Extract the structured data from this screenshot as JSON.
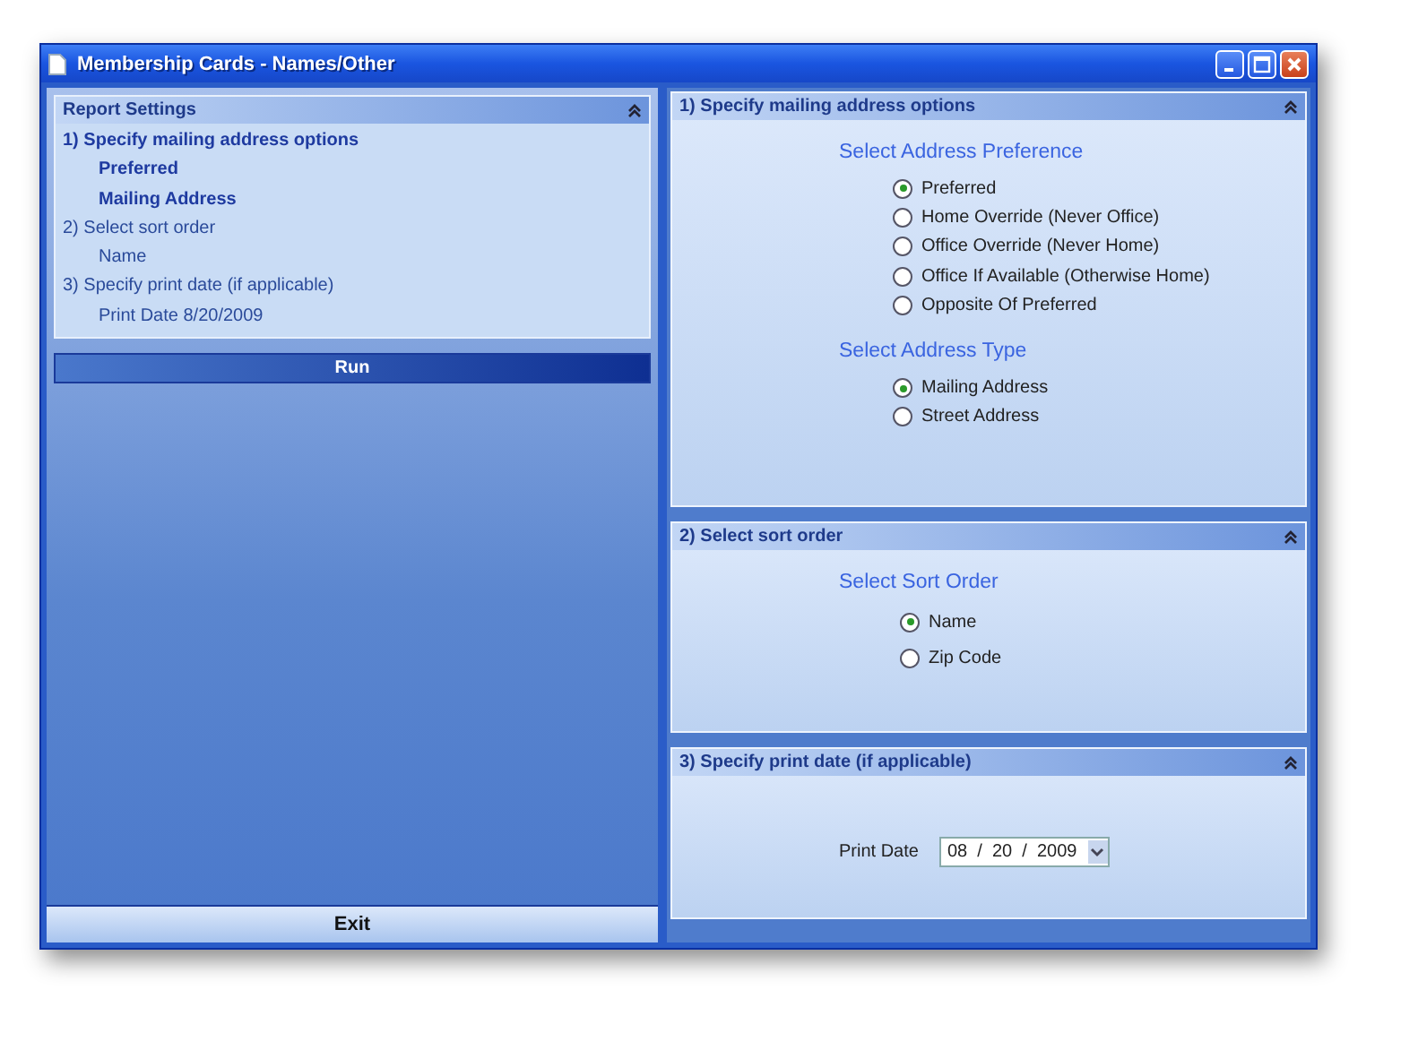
{
  "window": {
    "title": "Membership Cards - Names/Other"
  },
  "summary": {
    "title": "Report Settings",
    "items": [
      {
        "kind": "step",
        "bold": true,
        "text": "1)  Specify mailing address options"
      },
      {
        "kind": "value",
        "bold": true,
        "text": "Preferred"
      },
      {
        "kind": "value",
        "bold": true,
        "text": "Mailing Address"
      },
      {
        "kind": "step",
        "bold": false,
        "text": "2)  Select sort order"
      },
      {
        "kind": "value",
        "bold": false,
        "text": "Name"
      },
      {
        "kind": "step",
        "bold": false,
        "text": "3)  Specify print date (if applicable)"
      },
      {
        "kind": "value",
        "bold": false,
        "text": "Print Date  8/20/2009"
      }
    ]
  },
  "run_button": "Run",
  "exit_button": "Exit",
  "sections": [
    {
      "title": "1)  Specify mailing address options",
      "groups": [
        {
          "heading": "Select Address Preference",
          "options": [
            {
              "label": "Preferred",
              "selected": true
            },
            {
              "label": "Home Override (Never Office)",
              "selected": false
            },
            {
              "label": "Office Override (Never Home)",
              "selected": false
            },
            {
              "label": "Office If Available (Otherwise Home)",
              "selected": false
            },
            {
              "label": "Opposite Of Preferred",
              "selected": false
            }
          ]
        },
        {
          "heading": "Select Address Type",
          "options": [
            {
              "label": "Mailing Address",
              "selected": true
            },
            {
              "label": "Street Address",
              "selected": false
            }
          ]
        }
      ]
    },
    {
      "title": "2)  Select sort order",
      "groups": [
        {
          "heading": "Select Sort Order",
          "options": [
            {
              "label": "Name",
              "selected": true
            },
            {
              "label": "Zip Code",
              "selected": false
            }
          ]
        }
      ]
    },
    {
      "title": "3)  Specify print date (if applicable)",
      "date_field": {
        "label": "Print Date",
        "value": "08  /  20  /  2009"
      }
    }
  ]
}
